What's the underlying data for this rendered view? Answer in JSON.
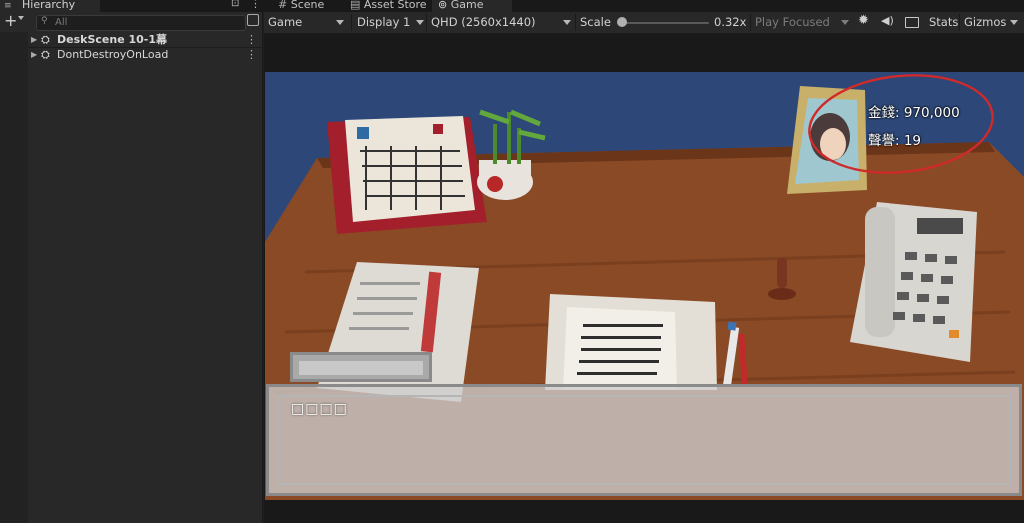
{
  "tabs": {
    "hierarchy": "Hierarchy",
    "scene": "Scene",
    "asset_store": "Asset Store",
    "game": "Game"
  },
  "hierarchy": {
    "add_label": "+",
    "search_placeholder": "All",
    "items": [
      {
        "label": "DeskScene 10-1幕"
      },
      {
        "label": "DontDestroyOnLoad"
      }
    ]
  },
  "game_toolbar": {
    "view_mode": "Game",
    "display": "Display 1",
    "resolution": "QHD (2560x1440)",
    "scale_label": "Scale",
    "scale_value": "0.32x",
    "scale_level": 0.05,
    "play_mode": "Play Focused",
    "stats": "Stats",
    "gizmos": "Gizmos"
  },
  "hud": {
    "money": "金錢: 970,000",
    "reputation": "聲譽: 19"
  },
  "dialog": {
    "text": "□□□□"
  },
  "colors": {
    "sky": "#2d4778",
    "desk": "#8a4a26",
    "annotation": "#d02a2a"
  }
}
